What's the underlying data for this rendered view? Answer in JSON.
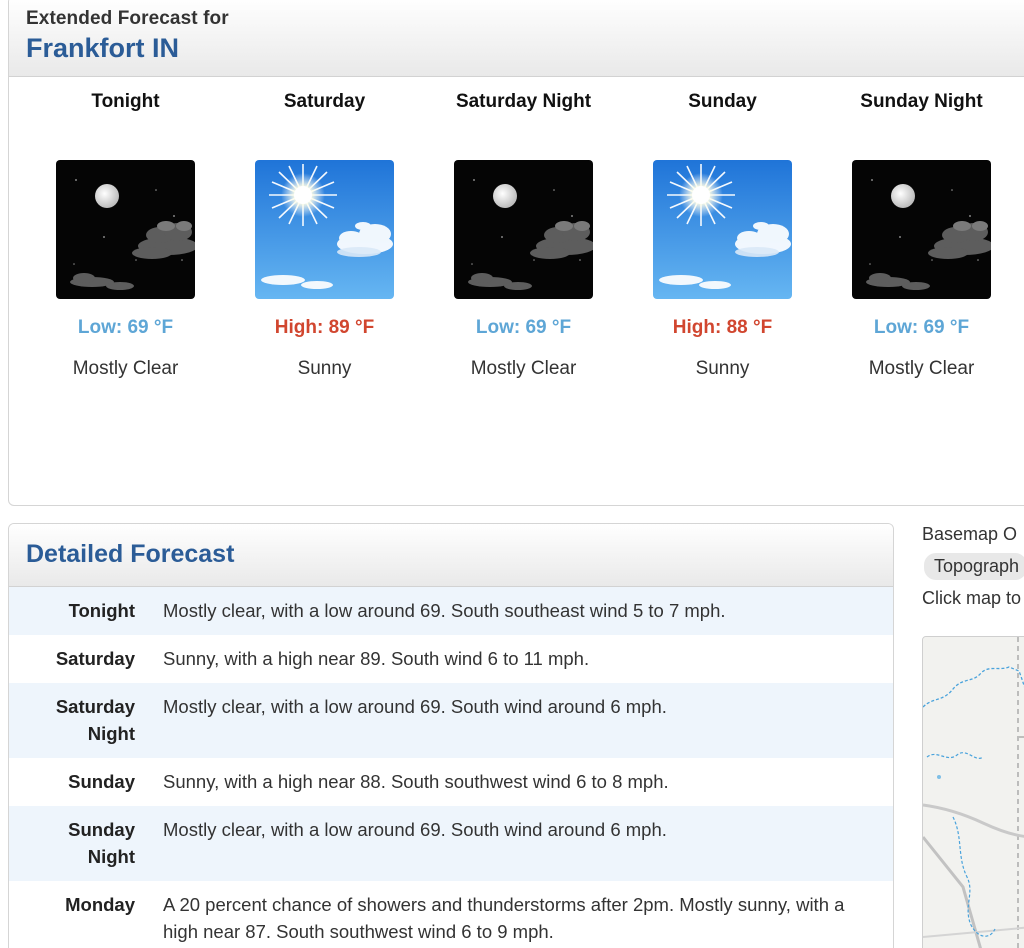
{
  "extended": {
    "subtitle": "Extended Forecast for",
    "location": "Frankfort IN",
    "periods": [
      {
        "name": "Tonight",
        "temp": "Low: 69 °F",
        "temp_kind": "low",
        "short": "Mostly Clear",
        "icon": "night-clear-icon"
      },
      {
        "name": "Saturday",
        "temp": "High: 89 °F",
        "temp_kind": "high",
        "short": "Sunny",
        "icon": "sunny-icon"
      },
      {
        "name": "Saturday Night",
        "temp": "Low: 69 °F",
        "temp_kind": "low",
        "short": "Mostly Clear",
        "icon": "night-clear-icon"
      },
      {
        "name": "Sunday",
        "temp": "High: 88 °F",
        "temp_kind": "high",
        "short": "Sunny",
        "icon": "sunny-icon"
      },
      {
        "name": "Sunday Night",
        "temp": "Low: 69 °F",
        "temp_kind": "low",
        "short": "Mostly Clear",
        "icon": "night-clear-icon"
      }
    ]
  },
  "detailed": {
    "title": "Detailed Forecast",
    "rows": [
      {
        "label1": "Tonight",
        "label2": "",
        "text": "Mostly clear, with a low around 69. South southeast wind 5 to 7 mph."
      },
      {
        "label1": "Saturday",
        "label2": "",
        "text": "Sunny, with a high near 89. South wind 6 to 11 mph."
      },
      {
        "label1": "Saturday",
        "label2": "Night",
        "text": "Mostly clear, with a low around 69. South wind around 6 mph."
      },
      {
        "label1": "Sunday",
        "label2": "",
        "text": "Sunny, with a high near 88. South southwest wind 6 to 8 mph."
      },
      {
        "label1": "Sunday",
        "label2": "Night",
        "text": "Mostly clear, with a low around 69. South wind around 6 mph."
      },
      {
        "label1": "Monday",
        "label2": "",
        "text": "A 20 percent chance of showers and thunderstorms after 2pm. Mostly sunny, with a high near 87. South southwest wind 6 to 9 mph."
      }
    ]
  },
  "side": {
    "basemap_label": "Basemap O",
    "basemap_value": "Topograph",
    "click_hint": "Click map to"
  },
  "colors": {
    "header_blue": "#2b5c97",
    "low_blue": "#5ea6d6",
    "high_red": "#d1462f",
    "row_alt": "#eef5fc"
  }
}
